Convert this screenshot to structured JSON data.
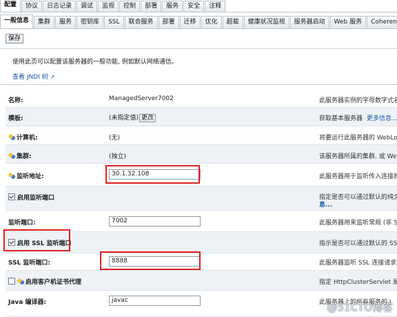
{
  "tabs_top": [
    "配置",
    "协议",
    "日志记录",
    "调试",
    "监视",
    "控制",
    "部署",
    "服务",
    "安全",
    "注释"
  ],
  "tabs_top_active": 0,
  "tabs_sub": [
    "一般信息",
    "集群",
    "服务",
    "密钥库",
    "SSL",
    "联合服务",
    "部署",
    "迁移",
    "优化",
    "超载",
    "健康状况监视",
    "服务器启动",
    "Web 服务",
    "Coherence"
  ],
  "tabs_sub_active": 0,
  "save_label": "保存",
  "intro_text": "使用此页可以配置该服务器的一般功能, 例如默认网络通信。",
  "jndi_link": "查看 JNDI 树",
  "fields": {
    "name": {
      "label": "名称:",
      "value": "ManagedServer7002",
      "desc": "此服务器实例的字母数字式名"
    },
    "template": {
      "label": "模板:",
      "value": "(未指定值)",
      "button": "更改",
      "desc": "获取基本服务器",
      "link": "更多信息..."
    },
    "machine": {
      "label": "计算机:",
      "value": "(无)",
      "desc": "将要运行此服务器的 WebLog"
    },
    "cluster": {
      "label": "集群:",
      "value": "(独立)",
      "desc": "该服务器所属的集群, 或 Web"
    },
    "listen_address": {
      "label": "监听地址:",
      "value": "30.1.32.108",
      "desc": "此服务器用于监听传入连接的"
    },
    "listen_port_enabled": {
      "label": "启用监听端口",
      "desc": "指定是否可以通过默认的纯文",
      "desc2": "息..."
    },
    "listen_port": {
      "label": "监听端口:",
      "value": "7002",
      "desc": "此服务器用来监听常规 (非 SS"
    },
    "ssl_port_enabled": {
      "label": "启用 SSL 监听端口",
      "desc": "指示是否可以通过默认的 SSL"
    },
    "ssl_port": {
      "label": "SSL 监听端口:",
      "value": "8888",
      "desc": "此服务器监听 SSL 连接请求的"
    },
    "client_cert_proxy": {
      "label": "启用客户机证书代理",
      "desc": "指定 HttpClusterServlet 是否"
    },
    "java_compiler": {
      "label": "Java 编译器:",
      "value": "javac",
      "desc": "此服务器上的所有服务的 J"
    }
  },
  "watermark": "@51CTO博客",
  "colors": {
    "highlight_box": "#e01e1e",
    "link": "#1a58a8"
  }
}
